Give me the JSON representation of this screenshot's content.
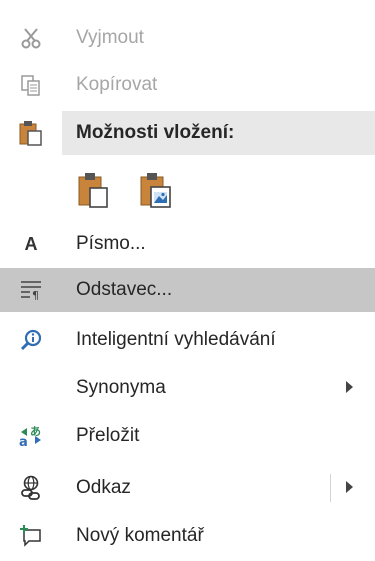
{
  "menu": {
    "cut": {
      "label": "Vyjmout",
      "icon": "scissors-icon"
    },
    "copy": {
      "label": "Kopírovat",
      "icon": "copy-icon"
    },
    "paste_options": {
      "label": "Možnosti vložení:",
      "icon": "clipboard-icon"
    },
    "paste_buttons": [
      {
        "icon": "paste-keep-formatting-icon"
      },
      {
        "icon": "paste-picture-icon"
      }
    ],
    "font": {
      "label": "Písmo...",
      "icon_text": "A",
      "icon": "font-icon"
    },
    "paragraph": {
      "label": "Odstavec...",
      "icon": "paragraph-icon"
    },
    "smart_lookup": {
      "label": "Inteligentní vyhledávání",
      "icon": "smart-lookup-icon"
    },
    "synonyms": {
      "label": "Synonyma",
      "icon": "submenu-arrow-icon"
    },
    "translate": {
      "label": "Přeložit",
      "icon": "translate-icon"
    },
    "link": {
      "label": "Odkaz",
      "icon": "link-icon"
    },
    "new_comment": {
      "label": "Nový komentář",
      "icon": "new-comment-icon"
    }
  },
  "colors": {
    "selected_bg": "#c6c6c6",
    "header_bg": "#e8e8e8",
    "disabled_text": "#a6a6a6",
    "accent_orange": "#c8843a",
    "accent_blue": "#2f6db5",
    "accent_green": "#2e8b57"
  }
}
